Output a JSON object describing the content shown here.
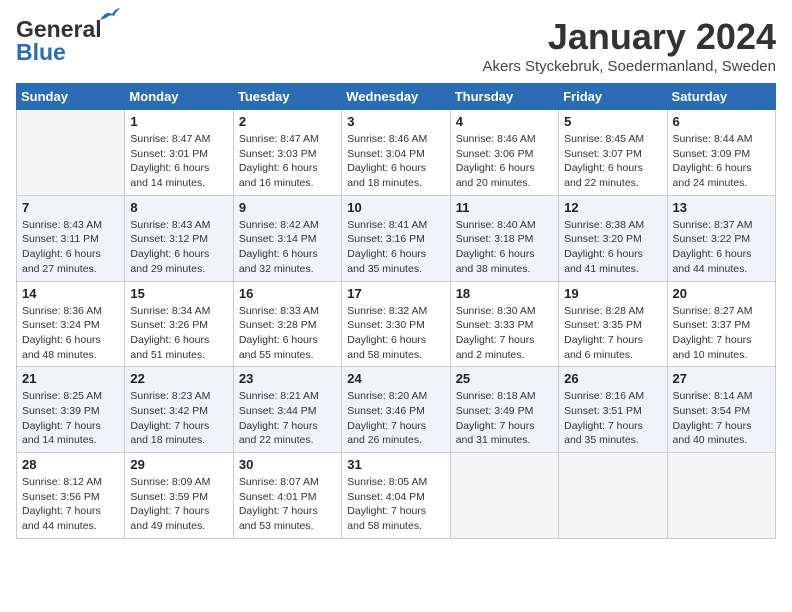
{
  "logo": {
    "line1": "General",
    "line2": "Blue"
  },
  "title": "January 2024",
  "subtitle": "Akers Styckebruk, Soedermanland, Sweden",
  "days_of_week": [
    "Sunday",
    "Monday",
    "Tuesday",
    "Wednesday",
    "Thursday",
    "Friday",
    "Saturday"
  ],
  "weeks": [
    [
      {
        "day": "",
        "sunrise": "",
        "sunset": "",
        "daylight": ""
      },
      {
        "day": "1",
        "sunrise": "Sunrise: 8:47 AM",
        "sunset": "Sunset: 3:01 PM",
        "daylight": "Daylight: 6 hours and 14 minutes."
      },
      {
        "day": "2",
        "sunrise": "Sunrise: 8:47 AM",
        "sunset": "Sunset: 3:03 PM",
        "daylight": "Daylight: 6 hours and 16 minutes."
      },
      {
        "day": "3",
        "sunrise": "Sunrise: 8:46 AM",
        "sunset": "Sunset: 3:04 PM",
        "daylight": "Daylight: 6 hours and 18 minutes."
      },
      {
        "day": "4",
        "sunrise": "Sunrise: 8:46 AM",
        "sunset": "Sunset: 3:06 PM",
        "daylight": "Daylight: 6 hours and 20 minutes."
      },
      {
        "day": "5",
        "sunrise": "Sunrise: 8:45 AM",
        "sunset": "Sunset: 3:07 PM",
        "daylight": "Daylight: 6 hours and 22 minutes."
      },
      {
        "day": "6",
        "sunrise": "Sunrise: 8:44 AM",
        "sunset": "Sunset: 3:09 PM",
        "daylight": "Daylight: 6 hours and 24 minutes."
      }
    ],
    [
      {
        "day": "7",
        "sunrise": "Sunrise: 8:43 AM",
        "sunset": "Sunset: 3:11 PM",
        "daylight": "Daylight: 6 hours and 27 minutes."
      },
      {
        "day": "8",
        "sunrise": "Sunrise: 8:43 AM",
        "sunset": "Sunset: 3:12 PM",
        "daylight": "Daylight: 6 hours and 29 minutes."
      },
      {
        "day": "9",
        "sunrise": "Sunrise: 8:42 AM",
        "sunset": "Sunset: 3:14 PM",
        "daylight": "Daylight: 6 hours and 32 minutes."
      },
      {
        "day": "10",
        "sunrise": "Sunrise: 8:41 AM",
        "sunset": "Sunset: 3:16 PM",
        "daylight": "Daylight: 6 hours and 35 minutes."
      },
      {
        "day": "11",
        "sunrise": "Sunrise: 8:40 AM",
        "sunset": "Sunset: 3:18 PM",
        "daylight": "Daylight: 6 hours and 38 minutes."
      },
      {
        "day": "12",
        "sunrise": "Sunrise: 8:38 AM",
        "sunset": "Sunset: 3:20 PM",
        "daylight": "Daylight: 6 hours and 41 minutes."
      },
      {
        "day": "13",
        "sunrise": "Sunrise: 8:37 AM",
        "sunset": "Sunset: 3:22 PM",
        "daylight": "Daylight: 6 hours and 44 minutes."
      }
    ],
    [
      {
        "day": "14",
        "sunrise": "Sunrise: 8:36 AM",
        "sunset": "Sunset: 3:24 PM",
        "daylight": "Daylight: 6 hours and 48 minutes."
      },
      {
        "day": "15",
        "sunrise": "Sunrise: 8:34 AM",
        "sunset": "Sunset: 3:26 PM",
        "daylight": "Daylight: 6 hours and 51 minutes."
      },
      {
        "day": "16",
        "sunrise": "Sunrise: 8:33 AM",
        "sunset": "Sunset: 3:28 PM",
        "daylight": "Daylight: 6 hours and 55 minutes."
      },
      {
        "day": "17",
        "sunrise": "Sunrise: 8:32 AM",
        "sunset": "Sunset: 3:30 PM",
        "daylight": "Daylight: 6 hours and 58 minutes."
      },
      {
        "day": "18",
        "sunrise": "Sunrise: 8:30 AM",
        "sunset": "Sunset: 3:33 PM",
        "daylight": "Daylight: 7 hours and 2 minutes."
      },
      {
        "day": "19",
        "sunrise": "Sunrise: 8:28 AM",
        "sunset": "Sunset: 3:35 PM",
        "daylight": "Daylight: 7 hours and 6 minutes."
      },
      {
        "day": "20",
        "sunrise": "Sunrise: 8:27 AM",
        "sunset": "Sunset: 3:37 PM",
        "daylight": "Daylight: 7 hours and 10 minutes."
      }
    ],
    [
      {
        "day": "21",
        "sunrise": "Sunrise: 8:25 AM",
        "sunset": "Sunset: 3:39 PM",
        "daylight": "Daylight: 7 hours and 14 minutes."
      },
      {
        "day": "22",
        "sunrise": "Sunrise: 8:23 AM",
        "sunset": "Sunset: 3:42 PM",
        "daylight": "Daylight: 7 hours and 18 minutes."
      },
      {
        "day": "23",
        "sunrise": "Sunrise: 8:21 AM",
        "sunset": "Sunset: 3:44 PM",
        "daylight": "Daylight: 7 hours and 22 minutes."
      },
      {
        "day": "24",
        "sunrise": "Sunrise: 8:20 AM",
        "sunset": "Sunset: 3:46 PM",
        "daylight": "Daylight: 7 hours and 26 minutes."
      },
      {
        "day": "25",
        "sunrise": "Sunrise: 8:18 AM",
        "sunset": "Sunset: 3:49 PM",
        "daylight": "Daylight: 7 hours and 31 minutes."
      },
      {
        "day": "26",
        "sunrise": "Sunrise: 8:16 AM",
        "sunset": "Sunset: 3:51 PM",
        "daylight": "Daylight: 7 hours and 35 minutes."
      },
      {
        "day": "27",
        "sunrise": "Sunrise: 8:14 AM",
        "sunset": "Sunset: 3:54 PM",
        "daylight": "Daylight: 7 hours and 40 minutes."
      }
    ],
    [
      {
        "day": "28",
        "sunrise": "Sunrise: 8:12 AM",
        "sunset": "Sunset: 3:56 PM",
        "daylight": "Daylight: 7 hours and 44 minutes."
      },
      {
        "day": "29",
        "sunrise": "Sunrise: 8:09 AM",
        "sunset": "Sunset: 3:59 PM",
        "daylight": "Daylight: 7 hours and 49 minutes."
      },
      {
        "day": "30",
        "sunrise": "Sunrise: 8:07 AM",
        "sunset": "Sunset: 4:01 PM",
        "daylight": "Daylight: 7 hours and 53 minutes."
      },
      {
        "day": "31",
        "sunrise": "Sunrise: 8:05 AM",
        "sunset": "Sunset: 4:04 PM",
        "daylight": "Daylight: 7 hours and 58 minutes."
      },
      {
        "day": "",
        "sunrise": "",
        "sunset": "",
        "daylight": ""
      },
      {
        "day": "",
        "sunrise": "",
        "sunset": "",
        "daylight": ""
      },
      {
        "day": "",
        "sunrise": "",
        "sunset": "",
        "daylight": ""
      }
    ]
  ]
}
